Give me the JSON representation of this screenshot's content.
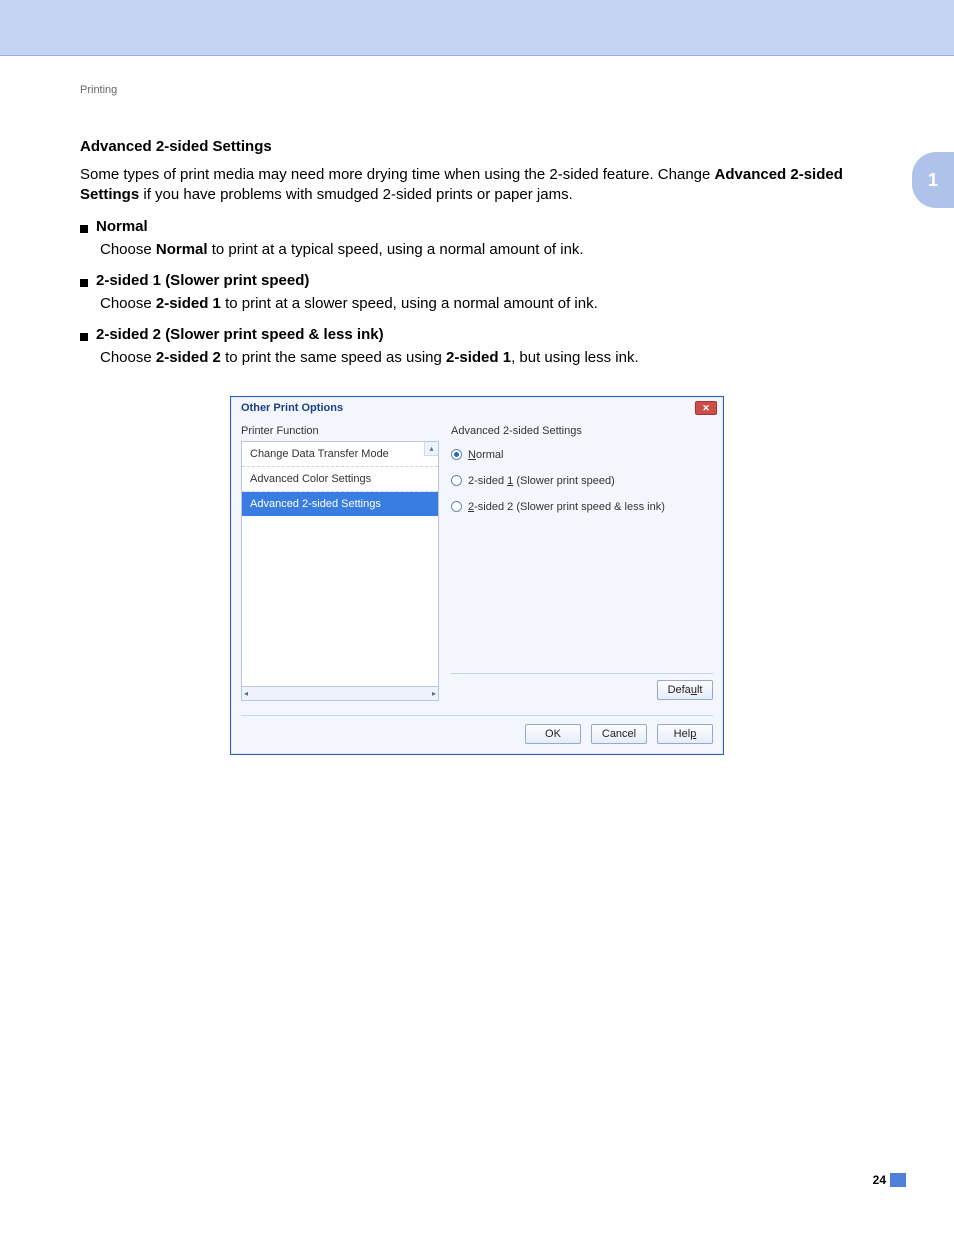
{
  "breadcrumb": "Printing",
  "sideTab": "1",
  "pageNumber": "24",
  "heading": "Advanced 2-sided Settings",
  "intro": {
    "pre": "Some types of print media may need more drying time when using the 2-sided feature. Change ",
    "bold": "Advanced 2-sided Settings",
    "post": " if you have problems with smudged 2-sided prints or paper jams."
  },
  "bullets": [
    {
      "label": "Normal",
      "desc_pre": "Choose ",
      "desc_bold": "Normal",
      "desc_post": " to print at a typical speed, using a normal amount of ink."
    },
    {
      "label": "2-sided 1 (Slower print speed)",
      "desc_pre": "Choose ",
      "desc_bold": "2-sided 1",
      "desc_post": " to print at a slower speed, using a normal amount of ink."
    },
    {
      "label": "2-sided 2 (Slower print speed & less ink)",
      "desc_pre": "Choose ",
      "desc_bold": "2-sided 2",
      "desc_mid": " to print the same speed as using ",
      "desc_bold2": "2-sided 1",
      "desc_post": ", but using less ink."
    }
  ],
  "dialog": {
    "title": "Other Print Options",
    "close": "✕",
    "leftLabel": "Printer Function",
    "listItems": [
      "Change Data Transfer Mode",
      "Advanced Color Settings",
      "Advanced 2-sided Settings"
    ],
    "selectedIndex": 2,
    "scrollLeft": "◂",
    "scrollRight": "▸",
    "scrollUp": "▴",
    "groupTitle": "Advanced 2-sided Settings",
    "radios": [
      {
        "ul": "N",
        "rest": "ormal",
        "checked": true
      },
      {
        "pre": "2-sided ",
        "ul": "1",
        "rest": " (Slower print speed)",
        "checked": false
      },
      {
        "pre": "",
        "ul": "2",
        "rest": "-sided 2 (Slower print speed & less ink)",
        "checked": false
      }
    ],
    "defaultBtn": {
      "pre": "Defa",
      "ul": "u",
      "post": "lt"
    },
    "buttons": {
      "ok": "OK",
      "cancel": "Cancel",
      "help": {
        "pre": "Hel",
        "ul": "p",
        "post": ""
      }
    }
  }
}
